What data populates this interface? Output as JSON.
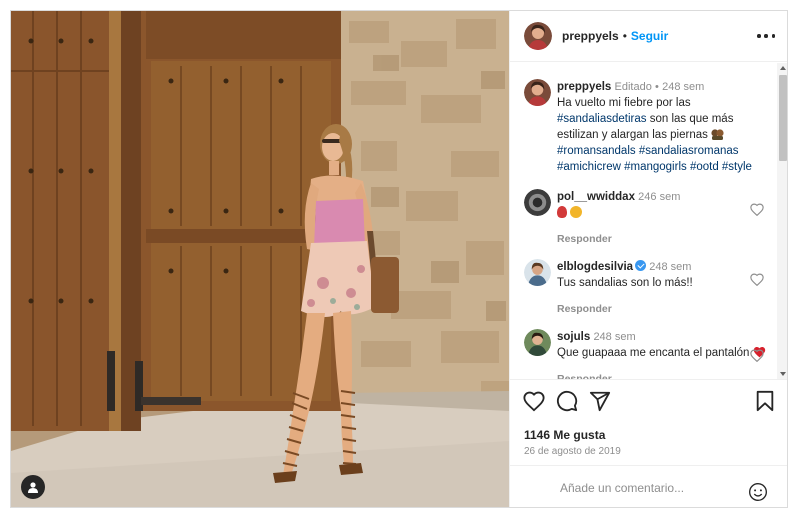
{
  "post": {
    "username": "preppyels",
    "follow_label": "Seguir",
    "separator": "•",
    "more_icon": "more-horizontal-icon"
  },
  "caption": {
    "username": "preppyels",
    "edited": "Editado",
    "dot": "•",
    "time": "248 sem",
    "text_line1": "Ha vuelto mi fiebre por las",
    "hashtag1": "#sandaliasdetiras",
    "text_line2": " son las que más estilizan y alargan las piernas",
    "hashtags_line": "#romansandals #sandaliasromanas #amichicrew #mangogirls #ootd #style"
  },
  "comments": [
    {
      "username": "pol__wwiddax",
      "time": "246 sem",
      "text": "",
      "reply": "Responder",
      "verified": false
    },
    {
      "username": "elblogdesilvia",
      "time": "248 sem",
      "text": "Tus sandalias son lo más!!",
      "reply": "Responder",
      "verified": true
    },
    {
      "username": "sojuls",
      "time": "248 sem",
      "text": "Que guapaaa me encanta el pantalón",
      "reply": "Responder",
      "verified": false
    }
  ],
  "actions": {
    "like_icon": "heart-icon",
    "comment_icon": "comment-icon",
    "share_icon": "send-icon",
    "save_icon": "bookmark-icon"
  },
  "likes": "1146 Me gusta",
  "date": "26 de agosto de 2019",
  "add_comment": {
    "placeholder": "Añade un comentario...",
    "emoji_icon": "smiley-icon"
  },
  "colors": {
    "accent": "#0095f6",
    "text": "#262626",
    "muted": "#8e8e8e",
    "border": "#dbdbdb",
    "like_red": "#ed4956"
  }
}
